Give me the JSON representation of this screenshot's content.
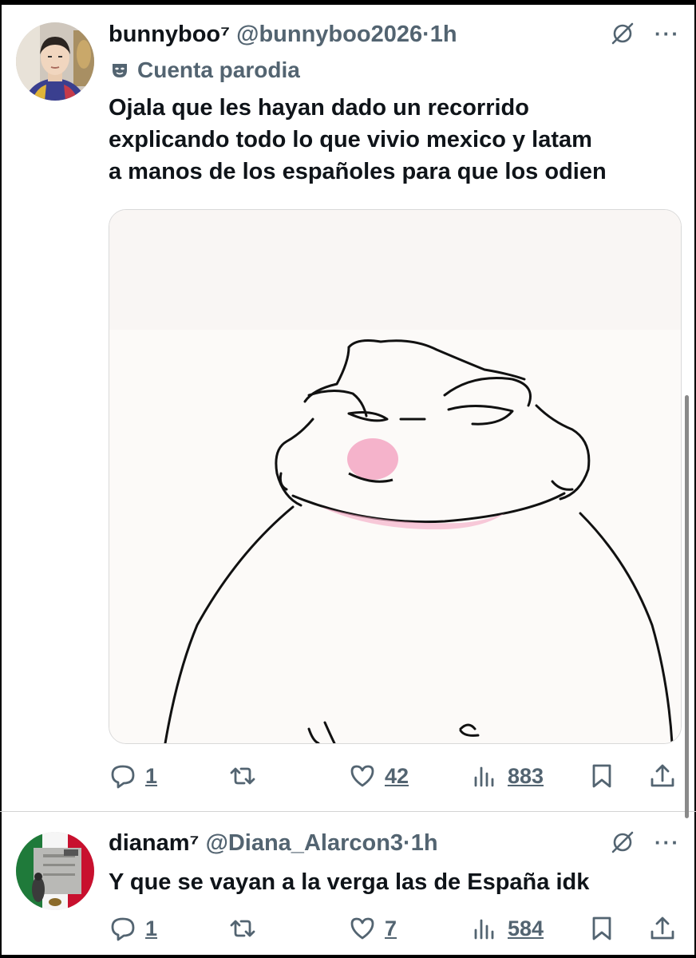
{
  "tweets": [
    {
      "display_name": "bunnyboo⁷",
      "handle": "@bunnyboo2026",
      "dot": "·",
      "time": "1h",
      "parody_label": "Cuenta parodia",
      "text_lines": [
        "Ojala que les hayan dado un recorrido",
        "explicando todo lo que vivio mexico y latam",
        "a manos de los españoles para que los odien"
      ],
      "media_icon": "meme-frog-drawing-image",
      "stats": {
        "replies": "1",
        "reposts": "",
        "likes": "42",
        "views": "883"
      }
    },
    {
      "display_name": "dianam⁷",
      "handle": "@Diana_Alarcon3",
      "dot": "·",
      "time": "1h",
      "text_lines": [
        "Y que se vayan a la verga las de España idk"
      ],
      "stats": {
        "replies": "1",
        "reposts": "",
        "likes": "7",
        "views": "584"
      }
    }
  ],
  "icons": {
    "more": "more-icon",
    "grok": "grok-icon",
    "reply": "reply-icon",
    "repost": "repost-icon",
    "like": "like-icon",
    "views": "views-icon",
    "bookmark": "bookmark-icon",
    "share": "share-icon",
    "parody": "mask-icon"
  },
  "more_glyph": "···",
  "colors": {
    "text": "#0f1419",
    "muted": "#536471",
    "divider": "#d4d4d4",
    "pink": "#f3a6c3"
  }
}
